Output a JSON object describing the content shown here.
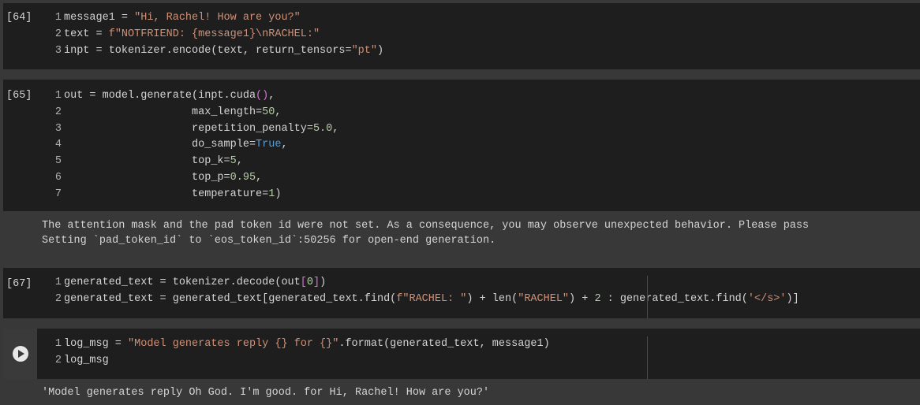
{
  "cells": [
    {
      "count": "[64]",
      "lines": [
        {
          "n": "1",
          "parts": [
            [
              "message1 = ",
              "pn"
            ],
            [
              "\"Hi, Rachel! How are you?\"",
              "str"
            ]
          ]
        },
        {
          "n": "2",
          "parts": [
            [
              "text = ",
              "pn"
            ],
            [
              "f\"NOTFRIEND: {message1}\\nRACHEL:\"",
              "str"
            ]
          ]
        },
        {
          "n": "3",
          "parts": [
            [
              "inpt = tokenizer.encode(text, return_tensors=",
              "pn"
            ],
            [
              "\"pt\"",
              "str"
            ],
            [
              ")",
              "pn"
            ]
          ]
        }
      ]
    },
    {
      "count": "[65]",
      "lines": [
        {
          "n": "1",
          "parts": [
            [
              "out = model.generate(inpt.cuda",
              "pn"
            ],
            [
              "()",
              "pnk"
            ],
            [
              ",",
              "pn"
            ]
          ]
        },
        {
          "n": "2",
          "parts": [
            [
              "                    max_length=",
              "pn"
            ],
            [
              "50",
              "num"
            ],
            [
              ",",
              "pn"
            ]
          ]
        },
        {
          "n": "3",
          "parts": [
            [
              "                    repetition_penalty=",
              "pn"
            ],
            [
              "5.0",
              "num"
            ],
            [
              ",",
              "pn"
            ]
          ]
        },
        {
          "n": "4",
          "parts": [
            [
              "                    do_sample=",
              "pn"
            ],
            [
              "True",
              "kw"
            ],
            [
              ",",
              "pn"
            ]
          ]
        },
        {
          "n": "5",
          "parts": [
            [
              "                    top_k=",
              "pn"
            ],
            [
              "5",
              "num"
            ],
            [
              ",",
              "pn"
            ]
          ]
        },
        {
          "n": "6",
          "parts": [
            [
              "                    top_p=",
              "pn"
            ],
            [
              "0.95",
              "num"
            ],
            [
              ",",
              "pn"
            ]
          ]
        },
        {
          "n": "7",
          "parts": [
            [
              "                    temperature=",
              "pn"
            ],
            [
              "1",
              "num"
            ],
            [
              ")",
              "pn"
            ]
          ]
        }
      ],
      "output": [
        "The attention mask and the pad token id were not set. As a consequence, you may observe unexpected behavior. Please pass",
        "Setting `pad_token_id` to `eos_token_id`:50256 for open-end generation."
      ]
    },
    {
      "count": "[67]",
      "lines": [
        {
          "n": "1",
          "parts": [
            [
              "generated_text = tokenizer.decode(out",
              "pn"
            ],
            [
              "[",
              "pnk"
            ],
            [
              "0",
              "num"
            ],
            [
              "]",
              "pnk"
            ],
            [
              ")",
              "pn"
            ]
          ]
        },
        {
          "n": "2",
          "parts": [
            [
              "generated_text = generated_text[generated_text.find(",
              "pn"
            ],
            [
              "f\"RACHEL: \"",
              "str"
            ],
            [
              ") + len(",
              "pn"
            ],
            [
              "\"RACHEL\"",
              "str"
            ],
            [
              ") + ",
              "pn"
            ],
            [
              "2",
              "num"
            ],
            [
              " : generated_text.find(",
              "pn"
            ],
            [
              "'</s>'",
              "str"
            ],
            [
              ")]",
              "pn"
            ]
          ]
        }
      ]
    },
    {
      "count": "",
      "lines": [
        {
          "n": "1",
          "parts": [
            [
              "log_msg = ",
              "pn"
            ],
            [
              "\"Model generates reply {} for {}\"",
              "str"
            ],
            [
              ".format(generated_text, message1)",
              "pn"
            ]
          ]
        },
        {
          "n": "2",
          "parts": [
            [
              "log_msg",
              "pn"
            ]
          ]
        }
      ],
      "output": [
        "'Model generates reply Oh God. I'm good. for Hi, Rachel! How are you?'"
      ]
    }
  ],
  "icons": {
    "run": "play-circle-icon"
  },
  "colors": {
    "string": "#ce9178",
    "number": "#b5cea8",
    "keyword": "#569cd6",
    "cell_bg": "#1e1e1e",
    "page_bg": "#383838"
  }
}
